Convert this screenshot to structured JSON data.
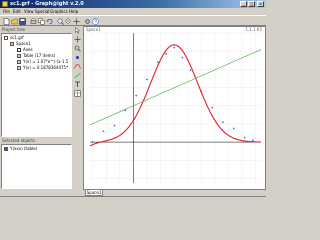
{
  "window": {
    "title": "sc1.grf - Graph@ight v.2.0",
    "minimize": "_",
    "maximize": "□",
    "close": "x"
  },
  "menu": [
    "File",
    "Edit",
    "View",
    "Special",
    "Graphics",
    "Help"
  ],
  "toolbar_icons": [
    "new-icon",
    "open-icon",
    "save-icon",
    "print-icon",
    "copy-icon",
    "undo-icon",
    "zoom-in-icon",
    "zoom-out-icon",
    "pan-icon",
    "settings-icon",
    "help-icon"
  ],
  "project_tree": {
    "header": "Project tree",
    "items": [
      {
        "label": "sc1.grf",
        "level": 0,
        "icon": "file-icon"
      },
      {
        "label": "Space1",
        "level": 1,
        "icon": "folder-icon"
      },
      {
        "label": "Axes",
        "level": 2,
        "icon": "axes-icon"
      },
      {
        "label": "Table (17 items)",
        "level": 2,
        "icon": "table-icon"
      },
      {
        "label": "Y(x) = 1.07*e^(-(x-1.5",
        "level": 2,
        "icon": "function-icon"
      },
      {
        "label": "Y(x) = 0.1878364475*",
        "level": 2,
        "icon": "function-icon"
      }
    ]
  },
  "selected_panel": {
    "header": "Selected objects",
    "items": [
      {
        "label": "Y(xxx) (table)",
        "icon": "table-icon"
      }
    ]
  },
  "graph": {
    "space_label": "Space1",
    "version": "1.1.1.65",
    "tab": "Space1",
    "colors": {
      "curve": "#e0202a",
      "line": "#3aa63a",
      "points": "#3030c0",
      "axes": "#000000"
    }
  },
  "chart_data": {
    "type": "scatter",
    "x": [
      -1.5,
      -1.1,
      -0.7,
      -0.3,
      0.1,
      0.5,
      0.9,
      1.2,
      1.5,
      1.8,
      2.1,
      2.5,
      2.9,
      3.3,
      3.7,
      4.1,
      4.4
    ],
    "y": [
      0.0,
      0.12,
      0.18,
      0.35,
      0.51,
      0.69,
      0.88,
      0.97,
      1.04,
      0.93,
      0.79,
      0.56,
      0.38,
      0.22,
      0.15,
      0.05,
      0.02
    ],
    "series": [
      {
        "type": "line",
        "kind": "gaussian",
        "color": "#e0202a"
      },
      {
        "type": "line",
        "kind": "linear",
        "color": "#3aa63a"
      },
      {
        "type": "scatter",
        "color": "#3030c0"
      }
    ],
    "xlim": [
      -1.6,
      4.7
    ],
    "ylim": [
      -0.45,
      1.2
    ],
    "grid": true
  }
}
